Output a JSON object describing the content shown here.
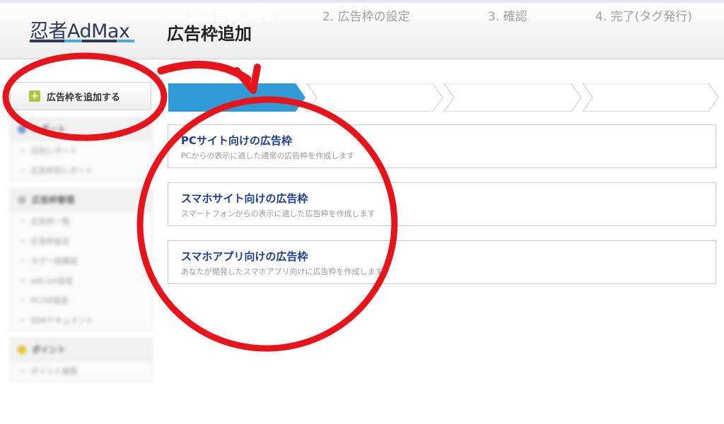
{
  "header": {
    "logo_text": "忍者AdMax",
    "page_title": "広告枠追加",
    "logo_colors": [
      "#2e3a55",
      "#2e3a55",
      "#4fa8d8",
      "#2e3a55",
      "#2e3a55",
      "#4fa8d8"
    ]
  },
  "sidebar": {
    "add_button_label": "広告枠を追加する",
    "panels": [
      {
        "title": "レポート",
        "dot_color": "#6f96d8",
        "items": [
          {
            "label": "日別レポート"
          },
          {
            "label": "広告枠別レポート"
          }
        ]
      },
      {
        "title": "広告枠管理",
        "dot_color": "#bbbbbb",
        "items": [
          {
            "label": "広告枠一覧"
          },
          {
            "label": "広告枠設定"
          },
          {
            "label": "タグ一括確認"
          },
          {
            "label": "ads.txt設定"
          },
          {
            "label": "PC/SP設定"
          },
          {
            "label": "SDKドキュメント"
          }
        ]
      },
      {
        "title": "ポイント",
        "dot_color": "#e8c22c",
        "items": [
          {
            "label": "ポイント履歴"
          }
        ]
      }
    ]
  },
  "steps": [
    {
      "label": "1. 広告枠の種類",
      "active": true
    },
    {
      "label": "2. 広告枠の設定",
      "active": false
    },
    {
      "label": "3. 確認",
      "active": false
    },
    {
      "label": "4. 完了(タグ発行)",
      "active": false
    }
  ],
  "options": [
    {
      "title": "PCサイト向けの広告枠",
      "desc": "PCからの表示に適した通常の広告枠を作成します"
    },
    {
      "title": "スマホサイト向けの広告枠",
      "desc": "スマートフォンからの表示に適した広告枠を作成します"
    },
    {
      "title": "スマホアプリ向けの広告枠",
      "desc": "あなたが開発したスマホアプリ向けに広告枠を作成します"
    }
  ],
  "colors": {
    "active_step": "#2f9ad6",
    "inactive_step_text": "#a0a0a0",
    "annotation_red": "#e8141c",
    "option_title": "#1f3d8a"
  }
}
